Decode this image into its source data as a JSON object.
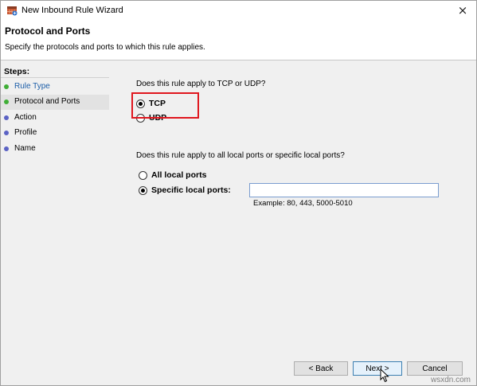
{
  "window": {
    "title": "New Inbound Rule Wizard",
    "close_icon": "×"
  },
  "header": {
    "title": "Protocol and Ports",
    "subtitle": "Specify the protocols and ports to which this rule applies."
  },
  "steps": {
    "title": "Steps:",
    "items": [
      {
        "label": "Rule Type",
        "status": "done",
        "color": "#3fae36"
      },
      {
        "label": "Protocol and Ports",
        "status": "current",
        "color": "#3fae36"
      },
      {
        "label": "Action",
        "status": "pending",
        "color": "#5b62c4"
      },
      {
        "label": "Profile",
        "status": "pending",
        "color": "#5b62c4"
      },
      {
        "label": "Name",
        "status": "pending",
        "color": "#5b62c4"
      }
    ]
  },
  "protocol": {
    "question": "Does this rule apply to TCP or UDP?",
    "options": [
      {
        "label": "TCP",
        "checked": true
      },
      {
        "label": "UDP",
        "checked": false
      }
    ],
    "highlight_color": "#e0161e"
  },
  "ports": {
    "question": "Does this rule apply to all local ports or specific local ports?",
    "options": [
      {
        "label": "All local ports",
        "checked": false
      },
      {
        "label": "Specific local ports:",
        "checked": true
      }
    ],
    "input_value": "",
    "example": "Example: 80, 443, 5000-5010"
  },
  "buttons": {
    "back": "< Back",
    "next": "Next >",
    "cancel": "Cancel"
  },
  "watermark": "wsxdn.com"
}
